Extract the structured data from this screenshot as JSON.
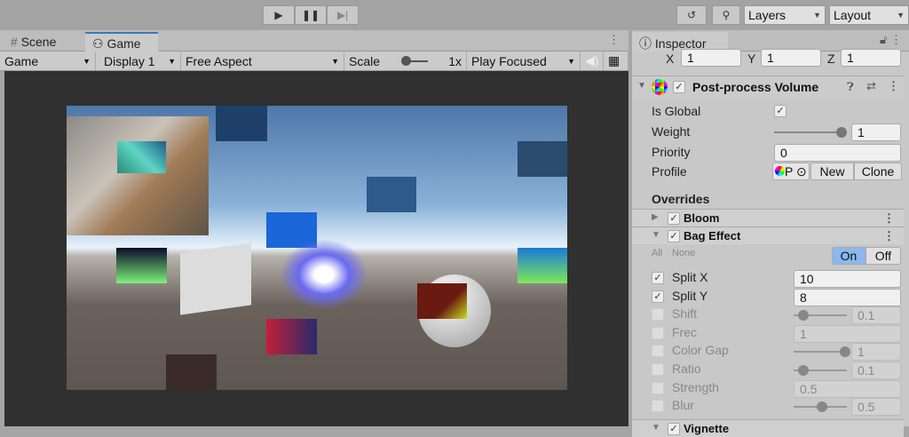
{
  "toolbar": {
    "layers": "Layers",
    "layout": "Layout"
  },
  "tabs": {
    "scene": "Scene",
    "game": "Game",
    "inspector": "Inspector"
  },
  "game_toolbar": {
    "mode": "Game",
    "display": "Display 1",
    "aspect": "Free Aspect",
    "scale_label": "Scale",
    "scale_value": "1x",
    "play_mode": "Play Focused"
  },
  "transform": {
    "x_label": "X",
    "x": "1",
    "y_label": "Y",
    "y": "1",
    "z_label": "Z",
    "z": "1"
  },
  "component": {
    "title": "Post-process Volume",
    "is_global_label": "Is Global",
    "weight_label": "Weight",
    "weight": "1",
    "priority_label": "Priority",
    "priority": "0",
    "profile_label": "Profile",
    "profile_value": "P",
    "new_label": "New",
    "clone_label": "Clone",
    "overrides_label": "Overrides"
  },
  "bloom": {
    "title": "Bloom"
  },
  "bag": {
    "title": "Bag Effect",
    "all": "All",
    "none": "None",
    "on": "On",
    "off": "Off",
    "params": [
      {
        "label": "Split X",
        "value": "10",
        "enabled": true,
        "slider": null
      },
      {
        "label": "Split Y",
        "value": "8",
        "enabled": true,
        "slider": null
      },
      {
        "label": "Shift",
        "value": "0.1",
        "enabled": false,
        "slider": 0.1
      },
      {
        "label": "Frec",
        "value": "1",
        "enabled": false,
        "slider": null
      },
      {
        "label": "Color Gap",
        "value": "1",
        "enabled": false,
        "slider": 1
      },
      {
        "label": "Ratio",
        "value": "0.1",
        "enabled": false,
        "slider": 0.1
      },
      {
        "label": "Strength",
        "value": "0.5",
        "enabled": false,
        "slider": null
      },
      {
        "label": "Blur",
        "value": "0.5",
        "enabled": false,
        "slider": 0.5
      }
    ]
  },
  "vignette": {
    "title": "Vignette"
  },
  "colors": {
    "accent": "#3a79bb",
    "on_button": "#8ab8ee"
  }
}
